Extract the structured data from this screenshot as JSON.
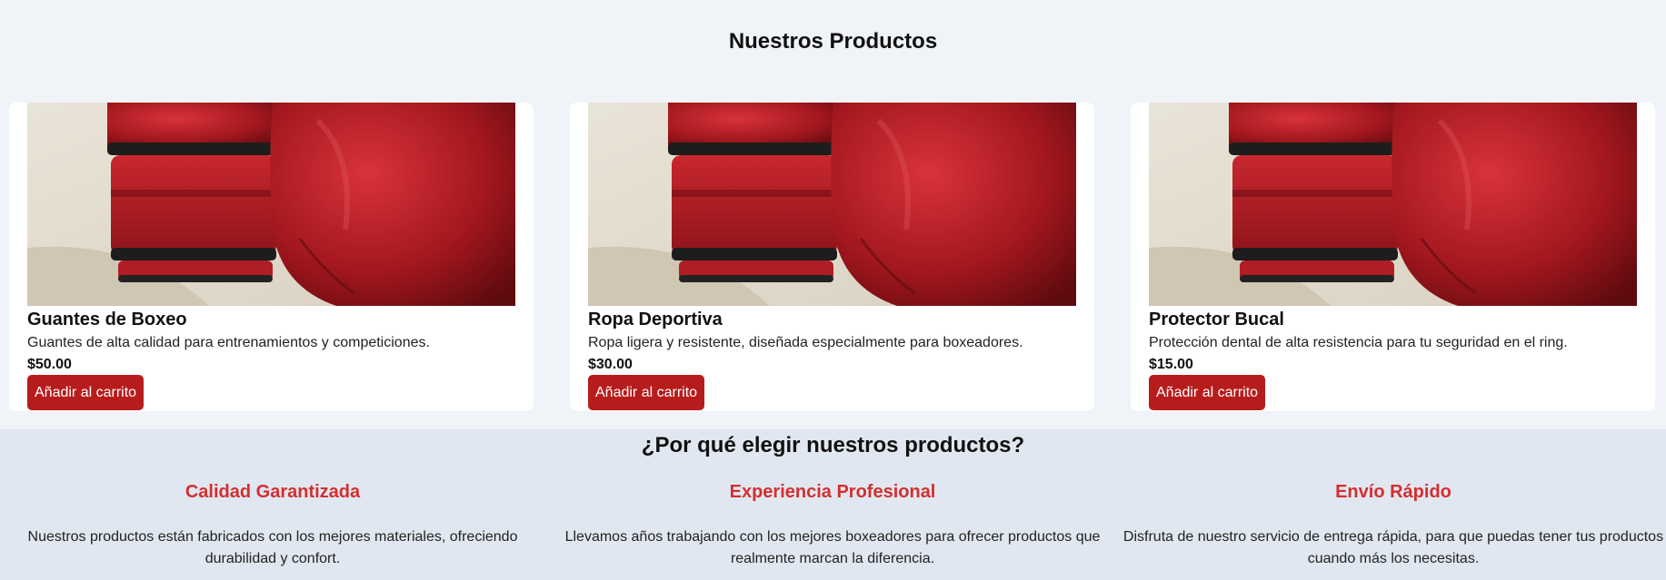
{
  "products_section": {
    "title": "Nuestros Productos",
    "products": [
      {
        "image_icon": "boxing-gloves-image",
        "name": "Guantes de Boxeo",
        "description": "Guantes de alta calidad para entrenamientos y competiciones.",
        "price": "$50.00",
        "button_label": "Añadir al carrito"
      },
      {
        "image_icon": "boxing-gloves-image",
        "name": "Ropa Deportiva",
        "description": "Ropa ligera y resistente, diseñada especialmente para boxeadores.",
        "price": "$30.00",
        "button_label": "Añadir al carrito"
      },
      {
        "image_icon": "boxing-gloves-image",
        "name": "Protector Bucal",
        "description": "Protección dental de alta resistencia para tu seguridad en el ring.",
        "price": "$15.00",
        "button_label": "Añadir al carrito"
      }
    ]
  },
  "why_section": {
    "title": "¿Por qué elegir nuestros productos?",
    "features": [
      {
        "title": "Calidad Garantizada",
        "text": "Nuestros productos están fabricados con los mejores materiales, ofreciendo durabilidad y confort."
      },
      {
        "title": "Experiencia Profesional",
        "text": "Llevamos años trabajando con los mejores boxeadores para ofrecer productos que realmente marcan la diferencia."
      },
      {
        "title": "Envío Rápido",
        "text": "Disfruta de nuestro servicio de entrega rápida, para que puedas tener tus productos cuando más los necesitas."
      }
    ]
  },
  "colors": {
    "page_background": "#f0f3f7",
    "why_background": "#e1e7f0",
    "button_background": "#b71c1c",
    "feature_title": "#d32f2f",
    "card_background": "#ffffff"
  }
}
